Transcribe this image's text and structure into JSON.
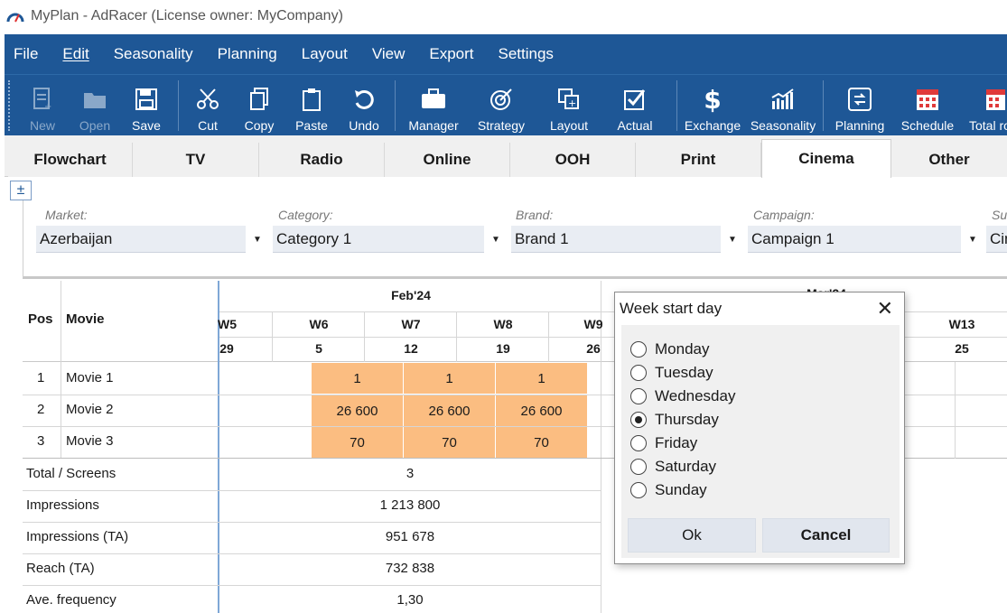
{
  "window": {
    "title": "MyPlan - AdRacer (License owner: MyCompany)"
  },
  "menu": [
    "File",
    "Edit",
    "Seasonality",
    "Planning",
    "Layout",
    "View",
    "Export",
    "Settings"
  ],
  "toolbar": {
    "new": "New",
    "open": "Open",
    "save": "Save",
    "cut": "Cut",
    "copy": "Copy",
    "paste": "Paste",
    "undo": "Undo",
    "manager": "Manager",
    "strategy": "Strategy",
    "layout": "Layout",
    "actual": "Actual",
    "exchange": "Exchange",
    "seasonality": "Seasonality",
    "planning": "Planning",
    "schedule": "Schedule",
    "total": "Total ro"
  },
  "tabs": [
    "Flowchart",
    "TV",
    "Radio",
    "Online",
    "OOH",
    "Print",
    "Cinema",
    "Other"
  ],
  "filters": {
    "expand": "±",
    "market_label": "Market:",
    "market_value": "Azerbaijan",
    "category_label": "Category:",
    "category_value": "Category 1",
    "brand_label": "Brand:",
    "brand_value": "Brand 1",
    "campaign_label": "Campaign:",
    "campaign_value": "Campaign 1",
    "next_label": "Su",
    "next_value": "Cin"
  },
  "grid": {
    "col_pos": "Pos",
    "col_movie": "Movie",
    "month1": "Feb'24",
    "month2": "Mar'24",
    "weeks": [
      "W5",
      "W6",
      "W7",
      "W8",
      "W9",
      "W13"
    ],
    "dates": [
      "29",
      "5",
      "12",
      "19",
      "26",
      "25"
    ],
    "rows": [
      {
        "pos": "1",
        "movie": "Movie 1",
        "values": [
          "1",
          "1",
          "1"
        ]
      },
      {
        "pos": "2",
        "movie": "Movie 2",
        "values": [
          "26 600",
          "26 600",
          "26 600"
        ]
      },
      {
        "pos": "3",
        "movie": "Movie 3",
        "values": [
          "70",
          "70",
          "70"
        ]
      }
    ],
    "summary": [
      {
        "label": "Total / Screens",
        "value": "3"
      },
      {
        "label": "Impressions",
        "value": "1 213 800"
      },
      {
        "label": "Impressions (TA)",
        "value": "951 678"
      },
      {
        "label": "Reach (TA)",
        "value": "732 838"
      },
      {
        "label": "Ave. frequency",
        "value": "1,30"
      }
    ]
  },
  "dialog": {
    "title": "Week start day",
    "close": "✕",
    "options": [
      "Monday",
      "Tuesday",
      "Wednesday",
      "Thursday",
      "Friday",
      "Saturday",
      "Sunday"
    ],
    "selected": "Thursday",
    "ok": "Ok",
    "cancel": "Cancel"
  },
  "colors": {
    "menu_bg": "#1e5796",
    "cell_highlight": "#fbbd81"
  }
}
